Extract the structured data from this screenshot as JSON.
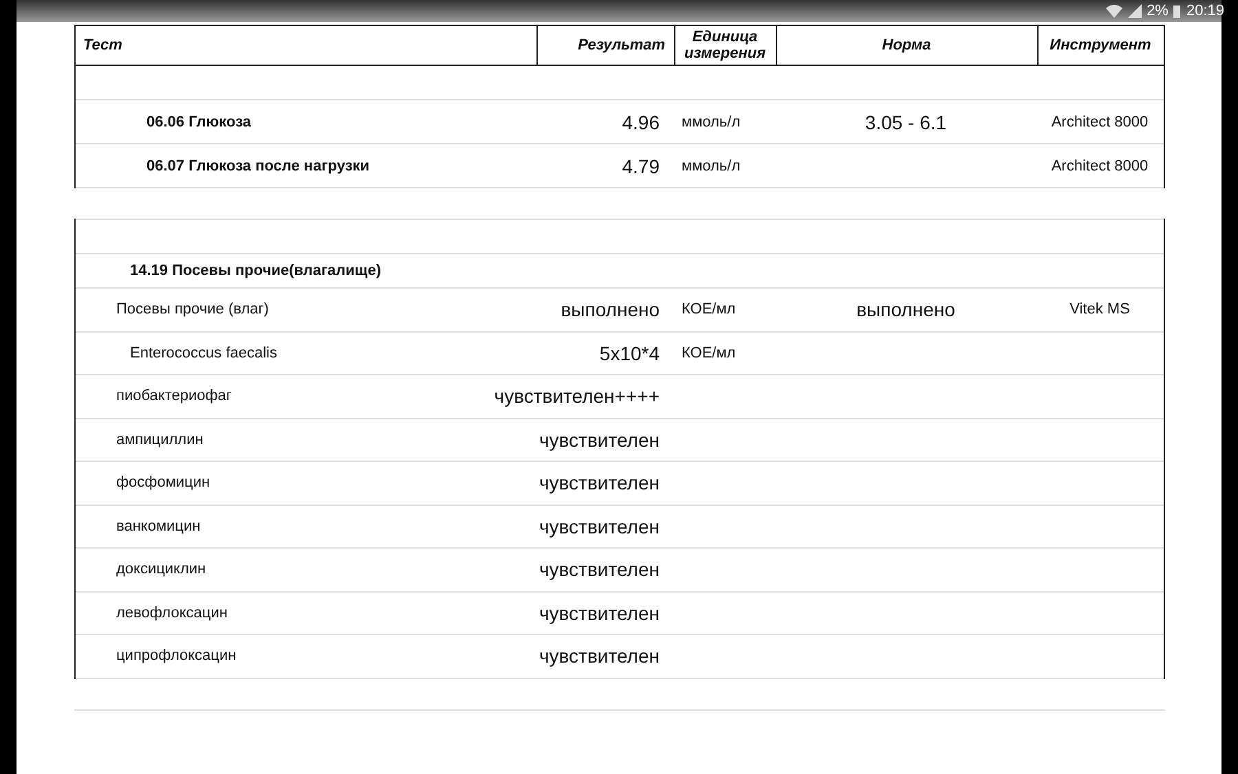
{
  "status_bar": {
    "battery": "2%",
    "time": "20:19"
  },
  "table1": {
    "columns": [
      {
        "label": "Тест"
      },
      {
        "label": "Результат"
      },
      {
        "label": "Единица измерения"
      },
      {
        "label": "Норма"
      },
      {
        "label": "Инструмент"
      }
    ],
    "rows": [
      {
        "kind": "blank"
      },
      {
        "kind": "test",
        "test": "06.06 Глюкоза",
        "result": "4.96",
        "unit": "ммоль/л",
        "norm": "3.05 - 6.1",
        "instrument": "Architect 8000"
      },
      {
        "kind": "test",
        "test": "06.07 Глюкоза после нагрузки",
        "result": "4.79",
        "unit": "ммоль/л",
        "instrument": "Architect 8000"
      }
    ]
  },
  "table2": {
    "rows": [
      {
        "kind": "blank"
      },
      {
        "kind": "section",
        "test": "14.19 Посевы прочие(влагалище)"
      },
      {
        "kind": "item",
        "test": "Посевы прочие (влаг)",
        "result": "выполнено",
        "unit": "КОЕ/мл",
        "norm": "выполнено",
        "instrument": "Vitek MS"
      },
      {
        "kind": "organism",
        "test": "Enterococcus faecalis",
        "result": "5x10*4",
        "unit": "КОЕ/мл"
      },
      {
        "kind": "item",
        "test": "пиобактериофаг",
        "result": "чувствителен++++"
      },
      {
        "kind": "item",
        "test": "ампициллин",
        "result": "чувствителен"
      },
      {
        "kind": "item",
        "test": "фосфомицин",
        "result": "чувствителен"
      },
      {
        "kind": "item",
        "test": "ванкомицин",
        "result": "чувствителен"
      },
      {
        "kind": "item",
        "test": "доксициклин",
        "result": "чувствителен"
      },
      {
        "kind": "item",
        "test": "левофлоксацин",
        "result": "чувствителен"
      },
      {
        "kind": "item",
        "test": "ципрофлоксацин",
        "result": "чувствителен"
      }
    ]
  }
}
